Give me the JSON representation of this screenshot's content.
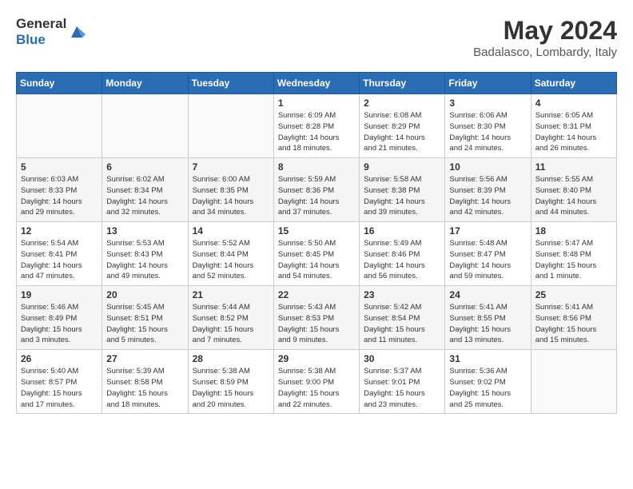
{
  "header": {
    "logo_line1": "General",
    "logo_line2": "Blue",
    "month": "May 2024",
    "location": "Badalasco, Lombardy, Italy"
  },
  "days_of_week": [
    "Sunday",
    "Monday",
    "Tuesday",
    "Wednesday",
    "Thursday",
    "Friday",
    "Saturday"
  ],
  "weeks": [
    [
      {
        "day": "",
        "info": ""
      },
      {
        "day": "",
        "info": ""
      },
      {
        "day": "",
        "info": ""
      },
      {
        "day": "1",
        "info": "Sunrise: 6:09 AM\nSunset: 8:28 PM\nDaylight: 14 hours\nand 18 minutes."
      },
      {
        "day": "2",
        "info": "Sunrise: 6:08 AM\nSunset: 8:29 PM\nDaylight: 14 hours\nand 21 minutes."
      },
      {
        "day": "3",
        "info": "Sunrise: 6:06 AM\nSunset: 8:30 PM\nDaylight: 14 hours\nand 24 minutes."
      },
      {
        "day": "4",
        "info": "Sunrise: 6:05 AM\nSunset: 8:31 PM\nDaylight: 14 hours\nand 26 minutes."
      }
    ],
    [
      {
        "day": "5",
        "info": "Sunrise: 6:03 AM\nSunset: 8:33 PM\nDaylight: 14 hours\nand 29 minutes."
      },
      {
        "day": "6",
        "info": "Sunrise: 6:02 AM\nSunset: 8:34 PM\nDaylight: 14 hours\nand 32 minutes."
      },
      {
        "day": "7",
        "info": "Sunrise: 6:00 AM\nSunset: 8:35 PM\nDaylight: 14 hours\nand 34 minutes."
      },
      {
        "day": "8",
        "info": "Sunrise: 5:59 AM\nSunset: 8:36 PM\nDaylight: 14 hours\nand 37 minutes."
      },
      {
        "day": "9",
        "info": "Sunrise: 5:58 AM\nSunset: 8:38 PM\nDaylight: 14 hours\nand 39 minutes."
      },
      {
        "day": "10",
        "info": "Sunrise: 5:56 AM\nSunset: 8:39 PM\nDaylight: 14 hours\nand 42 minutes."
      },
      {
        "day": "11",
        "info": "Sunrise: 5:55 AM\nSunset: 8:40 PM\nDaylight: 14 hours\nand 44 minutes."
      }
    ],
    [
      {
        "day": "12",
        "info": "Sunrise: 5:54 AM\nSunset: 8:41 PM\nDaylight: 14 hours\nand 47 minutes."
      },
      {
        "day": "13",
        "info": "Sunrise: 5:53 AM\nSunset: 8:43 PM\nDaylight: 14 hours\nand 49 minutes."
      },
      {
        "day": "14",
        "info": "Sunrise: 5:52 AM\nSunset: 8:44 PM\nDaylight: 14 hours\nand 52 minutes."
      },
      {
        "day": "15",
        "info": "Sunrise: 5:50 AM\nSunset: 8:45 PM\nDaylight: 14 hours\nand 54 minutes."
      },
      {
        "day": "16",
        "info": "Sunrise: 5:49 AM\nSunset: 8:46 PM\nDaylight: 14 hours\nand 56 minutes."
      },
      {
        "day": "17",
        "info": "Sunrise: 5:48 AM\nSunset: 8:47 PM\nDaylight: 14 hours\nand 59 minutes."
      },
      {
        "day": "18",
        "info": "Sunrise: 5:47 AM\nSunset: 8:48 PM\nDaylight: 15 hours\nand 1 minute."
      }
    ],
    [
      {
        "day": "19",
        "info": "Sunrise: 5:46 AM\nSunset: 8:49 PM\nDaylight: 15 hours\nand 3 minutes."
      },
      {
        "day": "20",
        "info": "Sunrise: 5:45 AM\nSunset: 8:51 PM\nDaylight: 15 hours\nand 5 minutes."
      },
      {
        "day": "21",
        "info": "Sunrise: 5:44 AM\nSunset: 8:52 PM\nDaylight: 15 hours\nand 7 minutes."
      },
      {
        "day": "22",
        "info": "Sunrise: 5:43 AM\nSunset: 8:53 PM\nDaylight: 15 hours\nand 9 minutes."
      },
      {
        "day": "23",
        "info": "Sunrise: 5:42 AM\nSunset: 8:54 PM\nDaylight: 15 hours\nand 11 minutes."
      },
      {
        "day": "24",
        "info": "Sunrise: 5:41 AM\nSunset: 8:55 PM\nDaylight: 15 hours\nand 13 minutes."
      },
      {
        "day": "25",
        "info": "Sunrise: 5:41 AM\nSunset: 8:56 PM\nDaylight: 15 hours\nand 15 minutes."
      }
    ],
    [
      {
        "day": "26",
        "info": "Sunrise: 5:40 AM\nSunset: 8:57 PM\nDaylight: 15 hours\nand 17 minutes."
      },
      {
        "day": "27",
        "info": "Sunrise: 5:39 AM\nSunset: 8:58 PM\nDaylight: 15 hours\nand 18 minutes."
      },
      {
        "day": "28",
        "info": "Sunrise: 5:38 AM\nSunset: 8:59 PM\nDaylight: 15 hours\nand 20 minutes."
      },
      {
        "day": "29",
        "info": "Sunrise: 5:38 AM\nSunset: 9:00 PM\nDaylight: 15 hours\nand 22 minutes."
      },
      {
        "day": "30",
        "info": "Sunrise: 5:37 AM\nSunset: 9:01 PM\nDaylight: 15 hours\nand 23 minutes."
      },
      {
        "day": "31",
        "info": "Sunrise: 5:36 AM\nSunset: 9:02 PM\nDaylight: 15 hours\nand 25 minutes."
      },
      {
        "day": "",
        "info": ""
      }
    ]
  ]
}
